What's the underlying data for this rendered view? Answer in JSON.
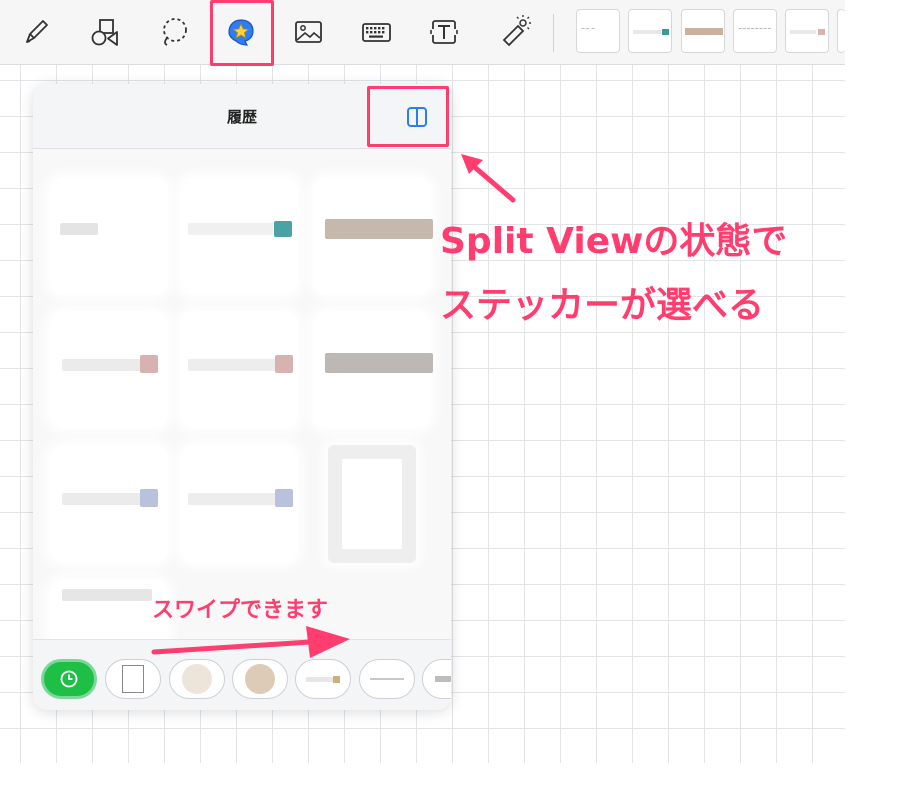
{
  "toolbar": {
    "tools": [
      {
        "name": "pen-tool",
        "icon": "pen-icon"
      },
      {
        "name": "shapes-tool",
        "icon": "shapes-icon"
      },
      {
        "name": "lasso-tool",
        "icon": "lasso-icon"
      },
      {
        "name": "sticker-tool",
        "icon": "sticker-icon",
        "active": true
      },
      {
        "name": "image-tool",
        "icon": "image-icon"
      },
      {
        "name": "keyboard-tool",
        "icon": "keyboard-icon"
      },
      {
        "name": "text-tool",
        "icon": "text-box-icon"
      },
      {
        "name": "laser-pointer-tool",
        "icon": "laser-pointer-icon"
      }
    ],
    "thumbnails": [
      {
        "label": "∼∼ ∼"
      },
      {
        "label": ""
      },
      {
        "label": ""
      },
      {
        "label": "∼∼∼∼∼∼∼∼"
      },
      {
        "label": ""
      }
    ]
  },
  "panel": {
    "title": "履歴",
    "split_view_icon": "split-view-icon"
  },
  "annotations": {
    "split_line1": "Split Viewの状態で",
    "split_line2": "ステッカーが選べる",
    "swipe": "スワイプできます"
  },
  "colors": {
    "accent": "#ff3d6e",
    "active_pill": "#1dbf45",
    "split_icon": "#2a7ff0",
    "sticker_icon": "#2e7cf6"
  },
  "category_pills": [
    {
      "name": "history",
      "icon": "clock-icon",
      "active": true
    },
    {
      "name": "paper",
      "icon": "paper-icon"
    },
    {
      "name": "beige-circle",
      "icon": "circle-icon"
    },
    {
      "name": "tan-circle",
      "icon": "circle-icon"
    },
    {
      "name": "tape-sticker",
      "icon": "tape-icon"
    },
    {
      "name": "line-sticker",
      "icon": "line-icon"
    },
    {
      "name": "gray-tape",
      "icon": "tape-icon"
    }
  ]
}
